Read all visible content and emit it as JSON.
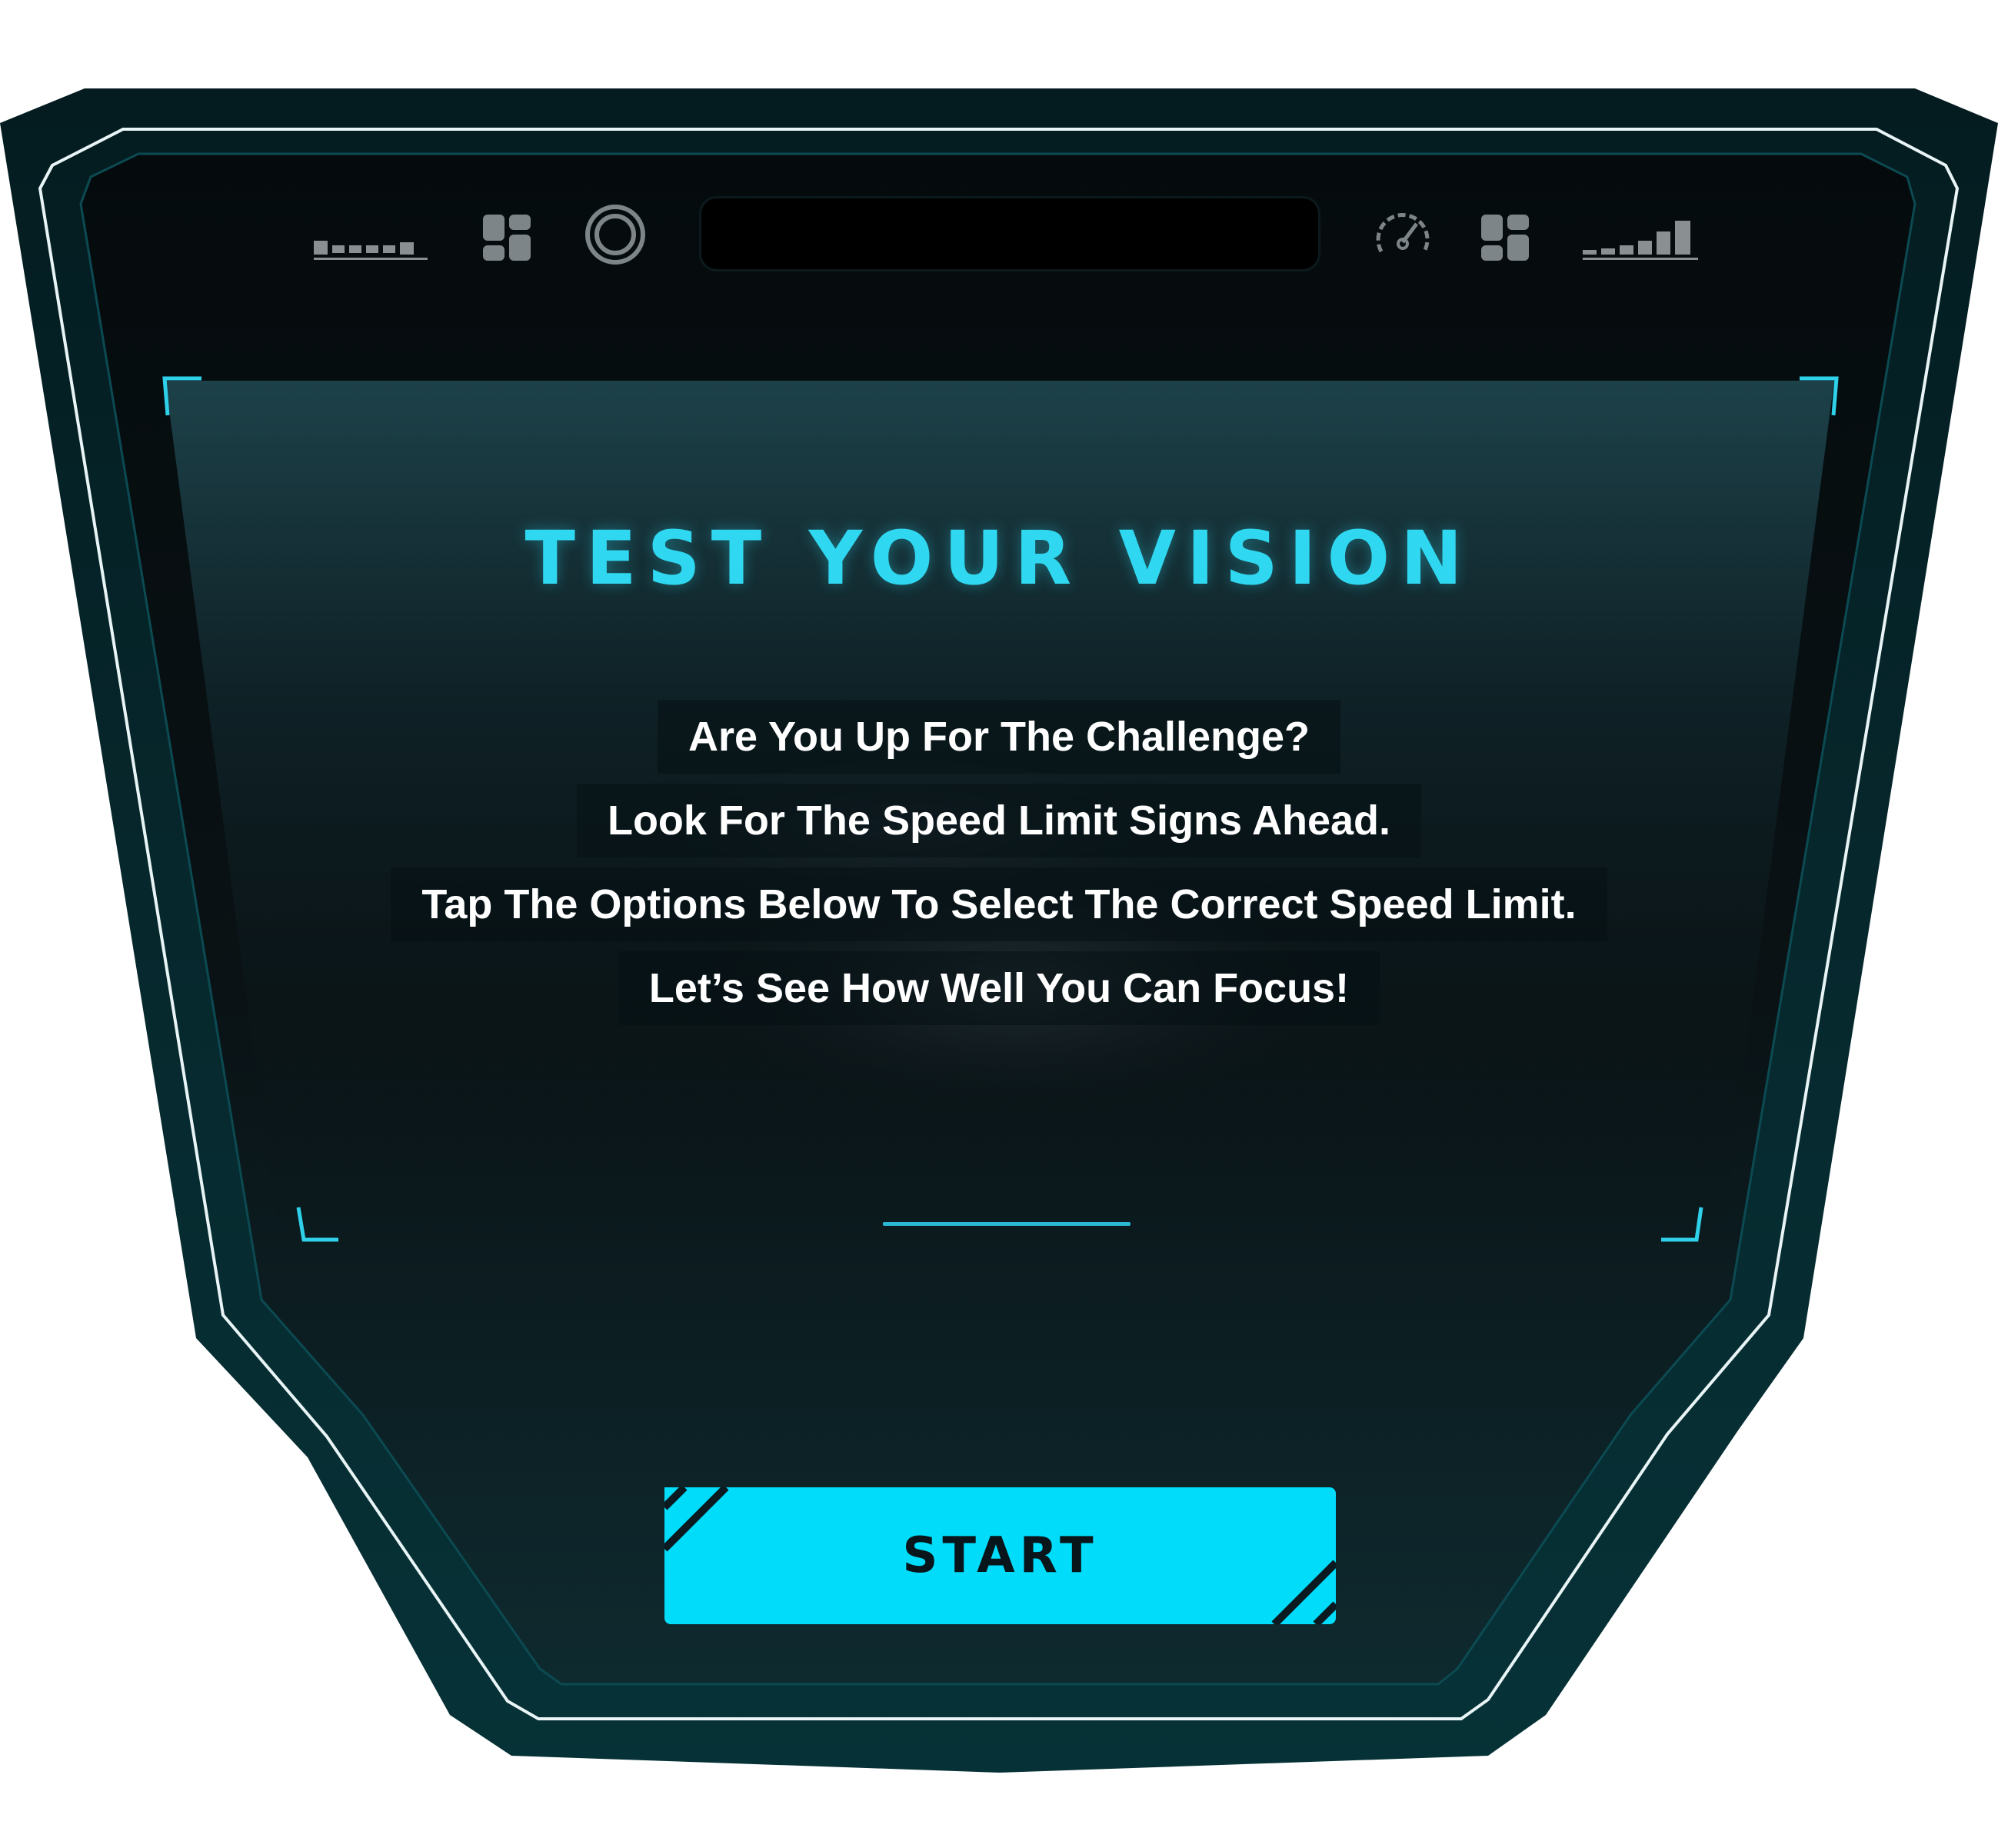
{
  "screen": {
    "title": "TEST YOUR VISION",
    "intro_lines": [
      "Are You Up For The Challenge?",
      "Look For The Speed Limit Signs Ahead.",
      "Tap The Options Below To Select The Correct Speed Limit.",
      "Let’s See How Well You Can Focus!"
    ],
    "start_label": "START"
  },
  "status_bar": {
    "left_icons": [
      "signal-bars-flat-icon",
      "grid-tiles-icon",
      "target-ring-icon"
    ],
    "right_icons": [
      "speedometer-icon",
      "grid-tiles-icon",
      "signal-bars-rising-icon"
    ]
  },
  "colors": {
    "accent": "#2fd8f0",
    "button": "#00dcfa",
    "frame_outer": "#063035",
    "screen_bg": "#0b1215",
    "text": "#ffffff"
  }
}
